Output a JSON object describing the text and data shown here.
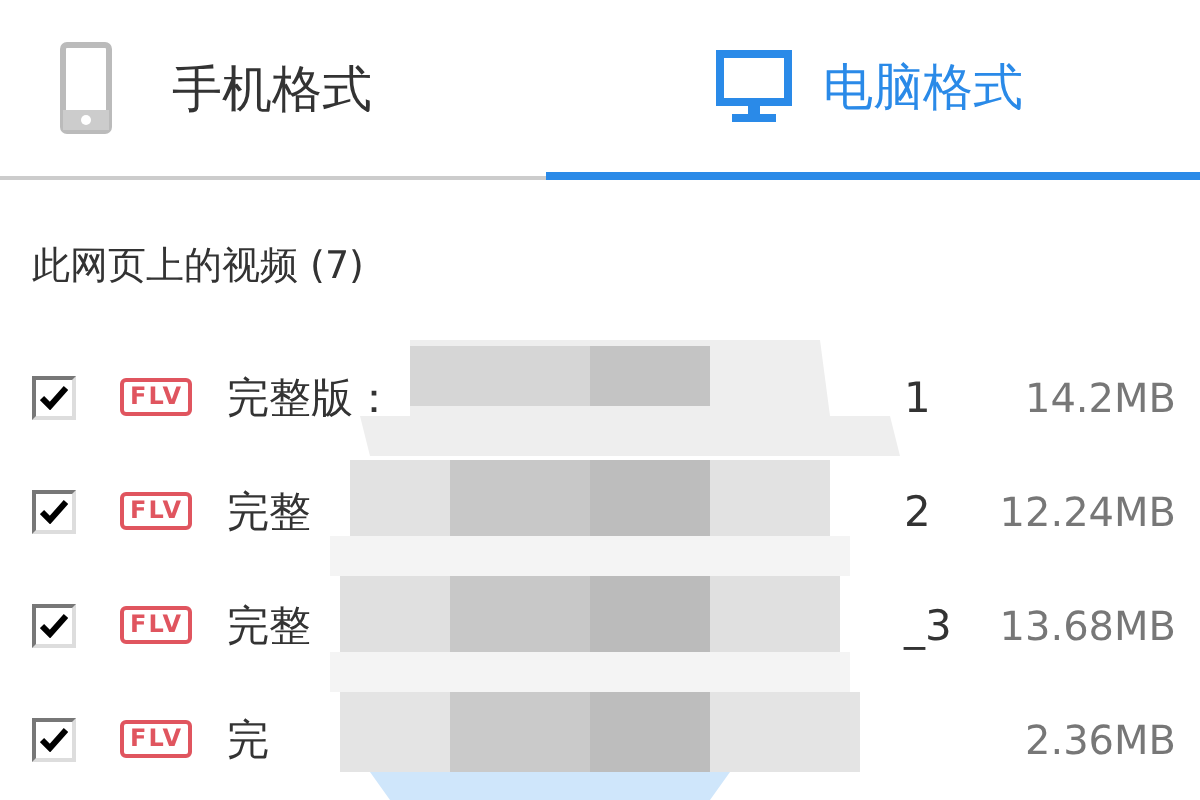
{
  "tabs": [
    {
      "label": "手机格式",
      "selected": false
    },
    {
      "label": "电脑格式",
      "selected": true
    }
  ],
  "heading": "此网页上的视频 (7)",
  "videos": [
    {
      "checked": true,
      "format": "FLV",
      "title": "完整版：",
      "tail": "1",
      "size": "14.2MB"
    },
    {
      "checked": true,
      "format": "FLV",
      "title": "完整",
      "tail": "2",
      "size": "12.24MB"
    },
    {
      "checked": true,
      "format": "FLV",
      "title": "完整",
      "tail": "_3",
      "size": "13.68MB"
    },
    {
      "checked": true,
      "format": "FLV",
      "title": "完",
      "size": "2.36MB"
    }
  ]
}
